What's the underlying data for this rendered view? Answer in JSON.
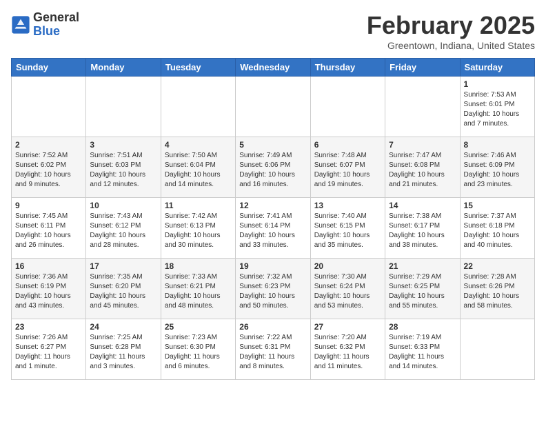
{
  "header": {
    "logo_general": "General",
    "logo_blue": "Blue",
    "month_title": "February 2025",
    "location": "Greentown, Indiana, United States"
  },
  "days_of_week": [
    "Sunday",
    "Monday",
    "Tuesday",
    "Wednesday",
    "Thursday",
    "Friday",
    "Saturday"
  ],
  "weeks": [
    [
      {
        "day": "",
        "info": ""
      },
      {
        "day": "",
        "info": ""
      },
      {
        "day": "",
        "info": ""
      },
      {
        "day": "",
        "info": ""
      },
      {
        "day": "",
        "info": ""
      },
      {
        "day": "",
        "info": ""
      },
      {
        "day": "1",
        "info": "Sunrise: 7:53 AM\nSunset: 6:01 PM\nDaylight: 10 hours\nand 7 minutes."
      }
    ],
    [
      {
        "day": "2",
        "info": "Sunrise: 7:52 AM\nSunset: 6:02 PM\nDaylight: 10 hours\nand 9 minutes."
      },
      {
        "day": "3",
        "info": "Sunrise: 7:51 AM\nSunset: 6:03 PM\nDaylight: 10 hours\nand 12 minutes."
      },
      {
        "day": "4",
        "info": "Sunrise: 7:50 AM\nSunset: 6:04 PM\nDaylight: 10 hours\nand 14 minutes."
      },
      {
        "day": "5",
        "info": "Sunrise: 7:49 AM\nSunset: 6:06 PM\nDaylight: 10 hours\nand 16 minutes."
      },
      {
        "day": "6",
        "info": "Sunrise: 7:48 AM\nSunset: 6:07 PM\nDaylight: 10 hours\nand 19 minutes."
      },
      {
        "day": "7",
        "info": "Sunrise: 7:47 AM\nSunset: 6:08 PM\nDaylight: 10 hours\nand 21 minutes."
      },
      {
        "day": "8",
        "info": "Sunrise: 7:46 AM\nSunset: 6:09 PM\nDaylight: 10 hours\nand 23 minutes."
      }
    ],
    [
      {
        "day": "9",
        "info": "Sunrise: 7:45 AM\nSunset: 6:11 PM\nDaylight: 10 hours\nand 26 minutes."
      },
      {
        "day": "10",
        "info": "Sunrise: 7:43 AM\nSunset: 6:12 PM\nDaylight: 10 hours\nand 28 minutes."
      },
      {
        "day": "11",
        "info": "Sunrise: 7:42 AM\nSunset: 6:13 PM\nDaylight: 10 hours\nand 30 minutes."
      },
      {
        "day": "12",
        "info": "Sunrise: 7:41 AM\nSunset: 6:14 PM\nDaylight: 10 hours\nand 33 minutes."
      },
      {
        "day": "13",
        "info": "Sunrise: 7:40 AM\nSunset: 6:15 PM\nDaylight: 10 hours\nand 35 minutes."
      },
      {
        "day": "14",
        "info": "Sunrise: 7:38 AM\nSunset: 6:17 PM\nDaylight: 10 hours\nand 38 minutes."
      },
      {
        "day": "15",
        "info": "Sunrise: 7:37 AM\nSunset: 6:18 PM\nDaylight: 10 hours\nand 40 minutes."
      }
    ],
    [
      {
        "day": "16",
        "info": "Sunrise: 7:36 AM\nSunset: 6:19 PM\nDaylight: 10 hours\nand 43 minutes."
      },
      {
        "day": "17",
        "info": "Sunrise: 7:35 AM\nSunset: 6:20 PM\nDaylight: 10 hours\nand 45 minutes."
      },
      {
        "day": "18",
        "info": "Sunrise: 7:33 AM\nSunset: 6:21 PM\nDaylight: 10 hours\nand 48 minutes."
      },
      {
        "day": "19",
        "info": "Sunrise: 7:32 AM\nSunset: 6:23 PM\nDaylight: 10 hours\nand 50 minutes."
      },
      {
        "day": "20",
        "info": "Sunrise: 7:30 AM\nSunset: 6:24 PM\nDaylight: 10 hours\nand 53 minutes."
      },
      {
        "day": "21",
        "info": "Sunrise: 7:29 AM\nSunset: 6:25 PM\nDaylight: 10 hours\nand 55 minutes."
      },
      {
        "day": "22",
        "info": "Sunrise: 7:28 AM\nSunset: 6:26 PM\nDaylight: 10 hours\nand 58 minutes."
      }
    ],
    [
      {
        "day": "23",
        "info": "Sunrise: 7:26 AM\nSunset: 6:27 PM\nDaylight: 11 hours\nand 1 minute."
      },
      {
        "day": "24",
        "info": "Sunrise: 7:25 AM\nSunset: 6:28 PM\nDaylight: 11 hours\nand 3 minutes."
      },
      {
        "day": "25",
        "info": "Sunrise: 7:23 AM\nSunset: 6:30 PM\nDaylight: 11 hours\nand 6 minutes."
      },
      {
        "day": "26",
        "info": "Sunrise: 7:22 AM\nSunset: 6:31 PM\nDaylight: 11 hours\nand 8 minutes."
      },
      {
        "day": "27",
        "info": "Sunrise: 7:20 AM\nSunset: 6:32 PM\nDaylight: 11 hours\nand 11 minutes."
      },
      {
        "day": "28",
        "info": "Sunrise: 7:19 AM\nSunset: 6:33 PM\nDaylight: 11 hours\nand 14 minutes."
      },
      {
        "day": "",
        "info": ""
      }
    ]
  ]
}
